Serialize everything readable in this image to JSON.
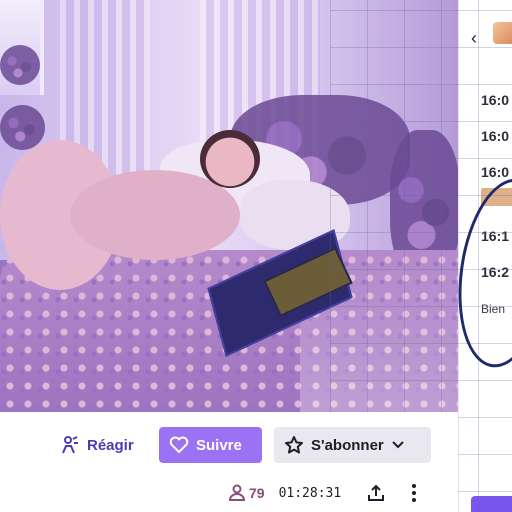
{
  "actions": {
    "react_label": "Réagir",
    "follow_label": "Suivre",
    "subscribe_label": "S'abonner"
  },
  "stream": {
    "viewers": "79",
    "uptime": "01:28:31"
  },
  "chat": {
    "times": [
      "16:0",
      "16:0",
      "16:0",
      "16:1",
      "16:2"
    ],
    "text": "Bien"
  },
  "colors": {
    "accent": "#9b72f4",
    "react_text": "#4d3bb0",
    "viewers": "#8b4c7a"
  },
  "icons": {
    "react": "react-icon",
    "follow": "heart-icon",
    "subscribe": "star-icon",
    "dropdown": "chevron-down-icon",
    "viewers": "person-icon",
    "share": "share-icon",
    "more": "more-vertical-icon",
    "back": "chevron-left-icon"
  }
}
